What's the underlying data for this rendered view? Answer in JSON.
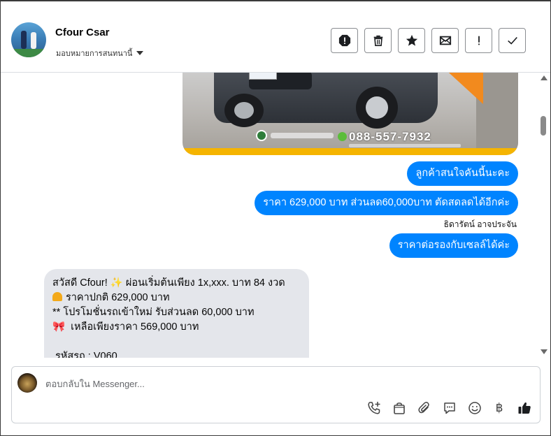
{
  "header": {
    "contact_name": "Cfour Csar",
    "assign_label": "มอบหมายการสนทนานี้"
  },
  "messages": {
    "image_phone": "088-557-7932",
    "outgoing": [
      "ลูกค้าสนใจคันนี้นะคะ",
      "ราคา 629,000 บาท ส่วนลด60,000บาท ตัดสดลดได้อีกค่ะ",
      "ราคาต่อรองกับเซลล์ได้ค่ะ"
    ],
    "sender_name": "ธิดารัตน์ อาจประจัน",
    "incoming_lines": [
      "สวัสดี Cfour! ✨  ผ่อนเริ่มต้นเพียง 1x,xxx. บาท 84 งวด",
      "ราคาปกติ 629,000 บาท",
      "** โปรโมชั่นรถเข้าใหม่ รับส่วนลด 60,000 บาท",
      "เหลือเพียงราคา 569,000 บาท",
      "",
      "รหัสรถ : V060"
    ]
  },
  "composer": {
    "placeholder": "ตอบกลับใน Messenger...",
    "currency_symbol": "฿"
  },
  "colors": {
    "outgoing_bubble": "#0084ff",
    "incoming_bubble": "#e4e6eb"
  }
}
